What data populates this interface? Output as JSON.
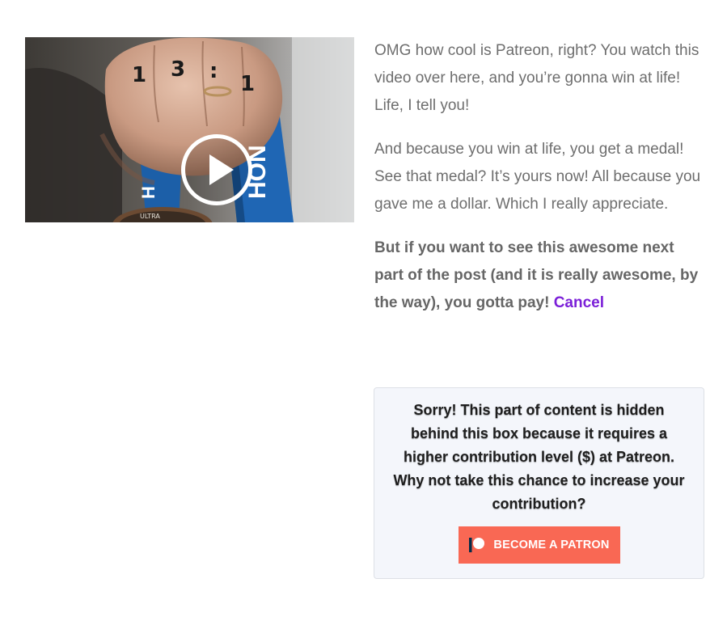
{
  "video": {
    "thumbnail_alt": "hand holding a finisher medal with a blue ribbon",
    "ribbon_text": "HON",
    "ribbon_text_left": "H",
    "fingers_text": "1 3 : 1",
    "medal_text": "ULTRA",
    "play_icon": "play-circle-icon"
  },
  "post": {
    "paragraph_1": "OMG how cool is Patreon, right? You watch this video over here, and you’re gonna win at life! Life, I tell you!",
    "paragraph_2": "And because you win at life, you get a medal! See that medal? It’s yours now! All because you gave me a dollar. Which I really appreciate.",
    "paragraph_3": "But if you want to see this awesome next part of the post (and it is really awesome, by the way), you gotta pay!",
    "cancel_link": "Cancel"
  },
  "gate": {
    "message": "Sorry! This part of content is hidden behind this box because it requires a higher contribution level ($) at Patreon. Why not take this chance to increase your contribution?",
    "button_label": "BECOME A PATRON",
    "button_icon": "patreon-logo-icon"
  },
  "colors": {
    "link_purple": "#7b1fd8",
    "patreon_coral": "#f96854",
    "gate_background": "#f4f6fb",
    "ribbon_blue": "#1f66b4"
  }
}
